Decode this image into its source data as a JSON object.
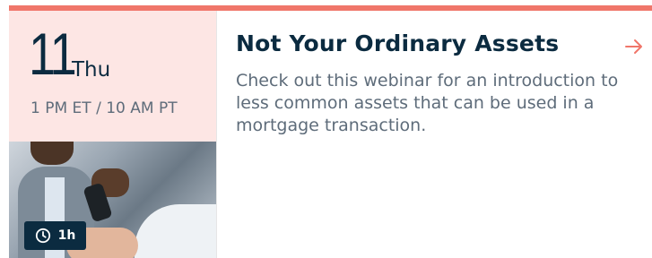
{
  "event": {
    "day_number": "11",
    "weekday": "Thu",
    "time": "1 PM ET / 10 AM PT",
    "duration": "1h",
    "title": "Not Your Ordinary Assets",
    "description": "Check out this webinar for an introduction to less common assets that can be used in a mortgage transaction."
  },
  "icons": {
    "duration": "clock-icon",
    "open": "arrow-right-icon"
  },
  "colors": {
    "accent": "#f0766a",
    "date_panel_bg": "#fde6e4",
    "navy": "#0b2b40",
    "muted_text": "#5e6c7a"
  }
}
